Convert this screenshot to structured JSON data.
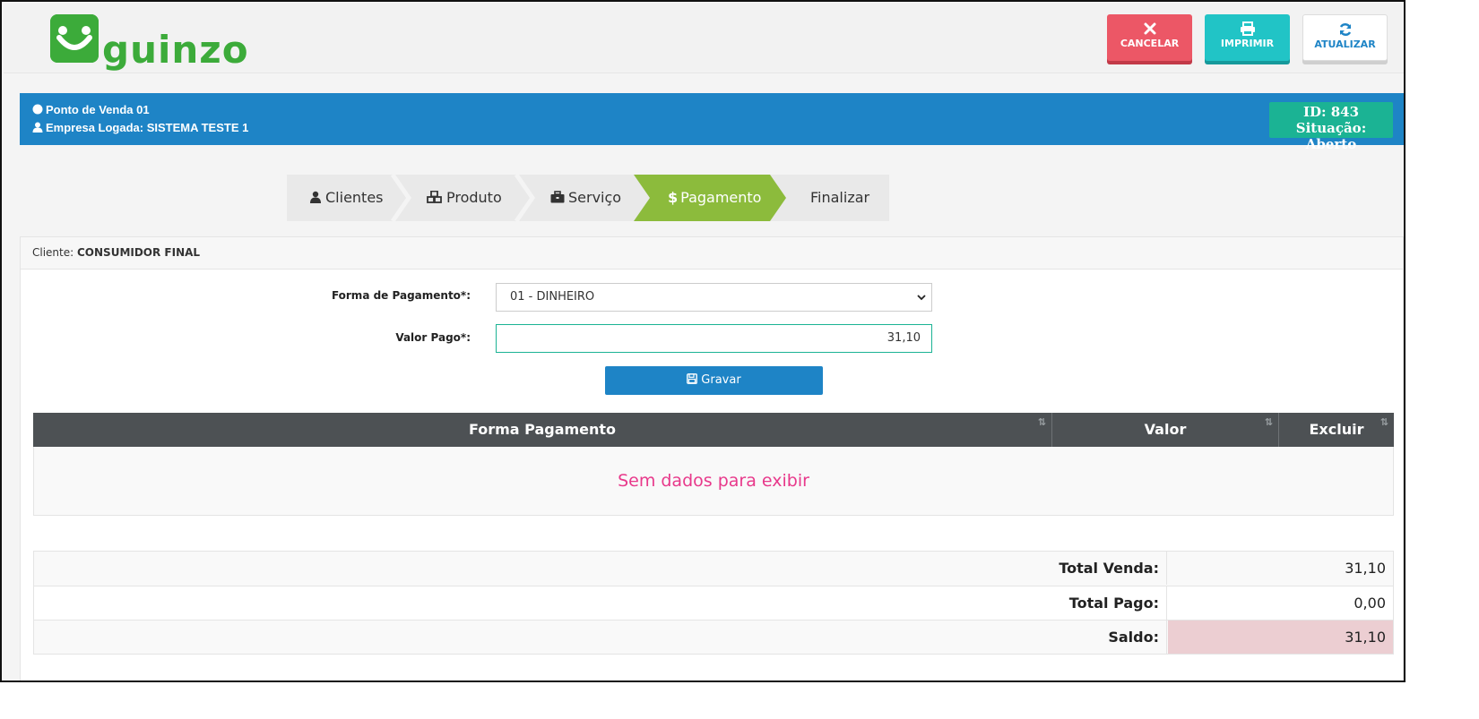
{
  "brand": {
    "name": "guinzo",
    "color": "#3cab3a"
  },
  "header_buttons": {
    "cancel": "CANCELAR",
    "print": "IMPRIMIR",
    "update": "ATUALIZAR"
  },
  "session": {
    "pos": "Ponto de Venda 01",
    "company": "Empresa Logada: SISTEMA TESTE 1",
    "id_label": "ID: 843",
    "status_label": "Situação: Aberto"
  },
  "steps": [
    {
      "label": "Clientes",
      "icon": "user-icon",
      "active": false
    },
    {
      "label": "Produto",
      "icon": "cubes-icon",
      "active": false
    },
    {
      "label": "Serviço",
      "icon": "briefcase-icon",
      "active": false
    },
    {
      "label": "Pagamento",
      "icon": "dollar-icon",
      "active": true
    },
    {
      "label": "Finalizar",
      "icon": "",
      "active": false
    }
  ],
  "client": {
    "prefix": "Cliente:",
    "name": "CONSUMIDOR FINAL"
  },
  "form": {
    "payment_method_label": "Forma de Pagamento*:",
    "payment_method_value": "01 - DINHEIRO",
    "amount_label": "Valor Pago*:",
    "amount_value": "31,10",
    "save_label": "Gravar"
  },
  "table": {
    "columns": [
      "Forma Pagamento",
      "Valor",
      "Excluir"
    ],
    "empty_message": "Sem dados para exibir"
  },
  "totals": [
    {
      "label": "Total Venda:",
      "value": "31,10"
    },
    {
      "label": "Total Pago:",
      "value": "0,00"
    },
    {
      "label": "Saldo:",
      "value": "31,10"
    }
  ],
  "colors": {
    "primary": "#1e84c6",
    "danger": "#ec5766",
    "info": "#21c4c6",
    "success": "#1bb394",
    "step_active": "#8cbb3c",
    "empty_text": "#e8398b"
  }
}
